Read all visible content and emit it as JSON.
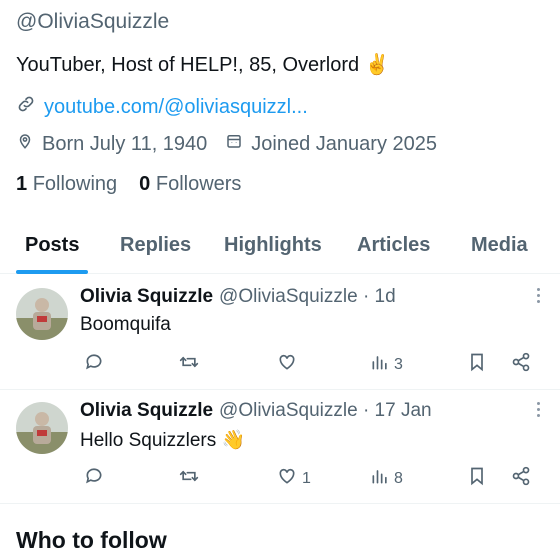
{
  "profile": {
    "handle": "@OliviaSquizzle",
    "bio": "YouTuber, Host of HELP!, 85, Overlord ✌️",
    "link": "youtube.com/@oliviasquizzl...",
    "born": "Born July 11, 1940",
    "joined": "Joined January 2025",
    "following_count": "1",
    "following_label": "Following",
    "followers_count": "0",
    "followers_label": "Followers"
  },
  "tabs": [
    {
      "label": "Posts",
      "active": true
    },
    {
      "label": "Replies"
    },
    {
      "label": "Highlights"
    },
    {
      "label": "Articles"
    },
    {
      "label": "Media"
    }
  ],
  "posts": [
    {
      "name": "Olivia Squizzle",
      "handle_time": "@OliviaSquizzle · 1d",
      "text": "Boomquifa",
      "likes": "",
      "views": "3"
    },
    {
      "name": "Olivia Squizzle",
      "handle_time": "@OliviaSquizzle · 17 Jan",
      "text": "Hello Squizzlers 👋",
      "likes": "1",
      "views": "8"
    }
  ],
  "who_to_follow": "Who to follow",
  "colors": {
    "accent": "#1d9bf0",
    "text_primary": "#0f1419",
    "text_secondary": "#536471"
  },
  "icons": [
    "link-icon",
    "location-icon",
    "calendar-icon",
    "reply-icon",
    "retweet-icon",
    "like-icon",
    "views-icon",
    "bookmark-icon",
    "share-icon",
    "more-icon"
  ]
}
